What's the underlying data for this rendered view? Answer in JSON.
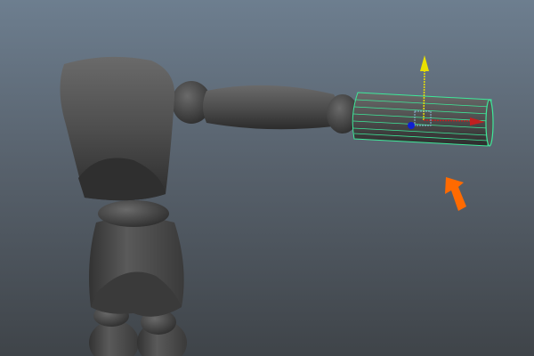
{
  "viewport": {
    "view": "perspective",
    "selected_object": "cylinder",
    "colors": {
      "background_top": "#6d7e8f",
      "background_bottom": "#3f4449",
      "mesh": "#555555",
      "selection_wire": "#3ee89a",
      "gizmo_y": "#e8e000",
      "gizmo_x": "#c02020",
      "gizmo_z": "#1020d0",
      "annotation_arrow": "#ff6a00"
    }
  }
}
